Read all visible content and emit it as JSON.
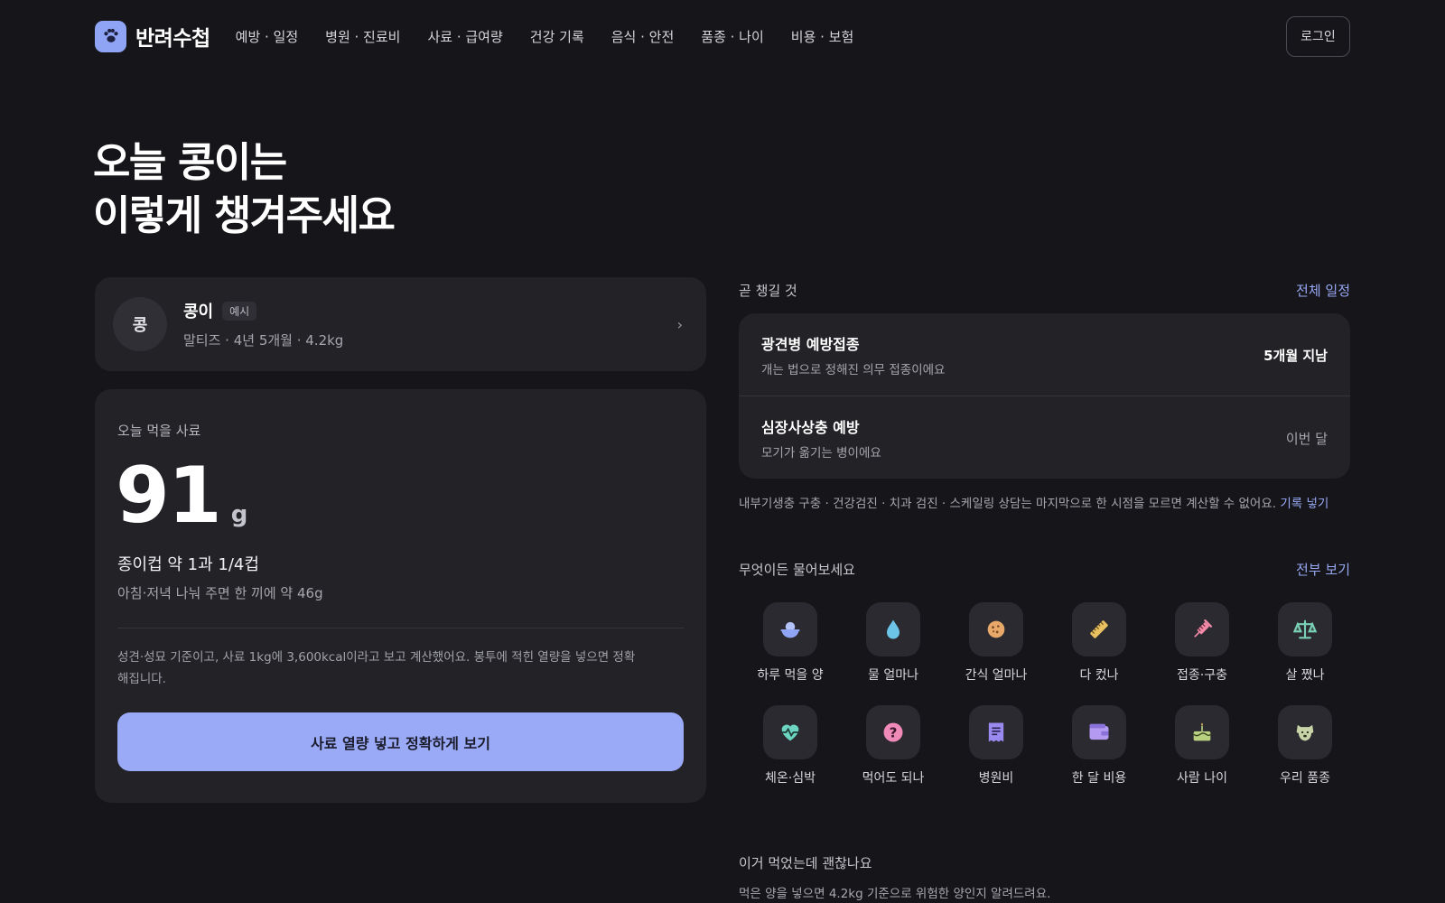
{
  "header": {
    "brand": "반려수첩",
    "nav": [
      "예방 · 일정",
      "병원 · 진료비",
      "사료 · 급여량",
      "건강 기록",
      "음식 · 안전",
      "품종 · 나이",
      "비용 · 보험"
    ],
    "login_label": "로그인",
    "accent_color": "#8fa4f5"
  },
  "hero": {
    "line1": "오늘 콩이는",
    "line2": "이렇게 챙겨주세요"
  },
  "pet": {
    "avatar_text": "콩",
    "name": "콩이",
    "badge": "예시",
    "details": "말티즈 · 4년 5개월 · 4.2kg",
    "chevron": "›"
  },
  "food": {
    "label": "오늘 먹을 사료",
    "amount": "91",
    "unit": "g",
    "cups": "종이컵 약 1과 1/4컵",
    "split": "아침·저녁 나눠 주면 한 끼에 약 46g",
    "note": "성견·성묘 기준이고, 사료 1kg에 3,600kcal이라고 보고 계산했어요. 봉투에 적힌 열량을 넣으면 정확해집니다.",
    "cta": "사료 열량 넣고 정확하게 보기"
  },
  "schedule": {
    "title": "곧 챙길 것",
    "link": "전체 일정",
    "items": [
      {
        "title": "광견병 예방접종",
        "desc": "개는 법으로 정해진 의무 접종이에요",
        "status": "5개월 지남"
      },
      {
        "title": "심장사상충 예방",
        "desc": "모기가 옮기는 병이에요",
        "status": "이번 달"
      }
    ],
    "note": "내부기생충 구충 · 건강검진 · 치과 검진 · 스케일링 상담는 마지막으로 한 시점을 모르면 계산할 수 없어요.",
    "note_link": "기록 넣기"
  },
  "questions": {
    "title": "무엇이든 물어보세요",
    "link": "전부 보기",
    "items": [
      {
        "label": "하루 먹을 양",
        "icon": "food-bowl-icon",
        "color": "#8fa4f5"
      },
      {
        "label": "물 얼마나",
        "icon": "water-drop-icon",
        "color": "#6cc4e8"
      },
      {
        "label": "간식 얼마나",
        "icon": "cookie-icon",
        "color": "#e8a86a"
      },
      {
        "label": "다 컸나",
        "icon": "ruler-icon",
        "color": "#e8c060"
      },
      {
        "label": "접종·구충",
        "icon": "syringe-icon",
        "color": "#f08aa8"
      },
      {
        "label": "살 쪘나",
        "icon": "scale-icon",
        "color": "#7ad0b4"
      },
      {
        "label": "체온·심박",
        "icon": "heartbeat-icon",
        "color": "#6cd4c0"
      },
      {
        "label": "먹어도 되나",
        "icon": "question-icon",
        "color": "#f08ab8"
      },
      {
        "label": "병원비",
        "icon": "receipt-icon",
        "color": "#9a8af0"
      },
      {
        "label": "한 달 비용",
        "icon": "wallet-icon",
        "color": "#b49af0"
      },
      {
        "label": "사람 나이",
        "icon": "cake-icon",
        "color": "#b8d080"
      },
      {
        "label": "우리 품종",
        "icon": "dog-face-icon",
        "color": "#c8d4a8"
      }
    ]
  },
  "eaten": {
    "title": "이거 먹었는데 괜찮나요",
    "desc": "먹은 양을 넣으면 4.2kg 기준으로 위험한 양인지 알려드려요."
  }
}
